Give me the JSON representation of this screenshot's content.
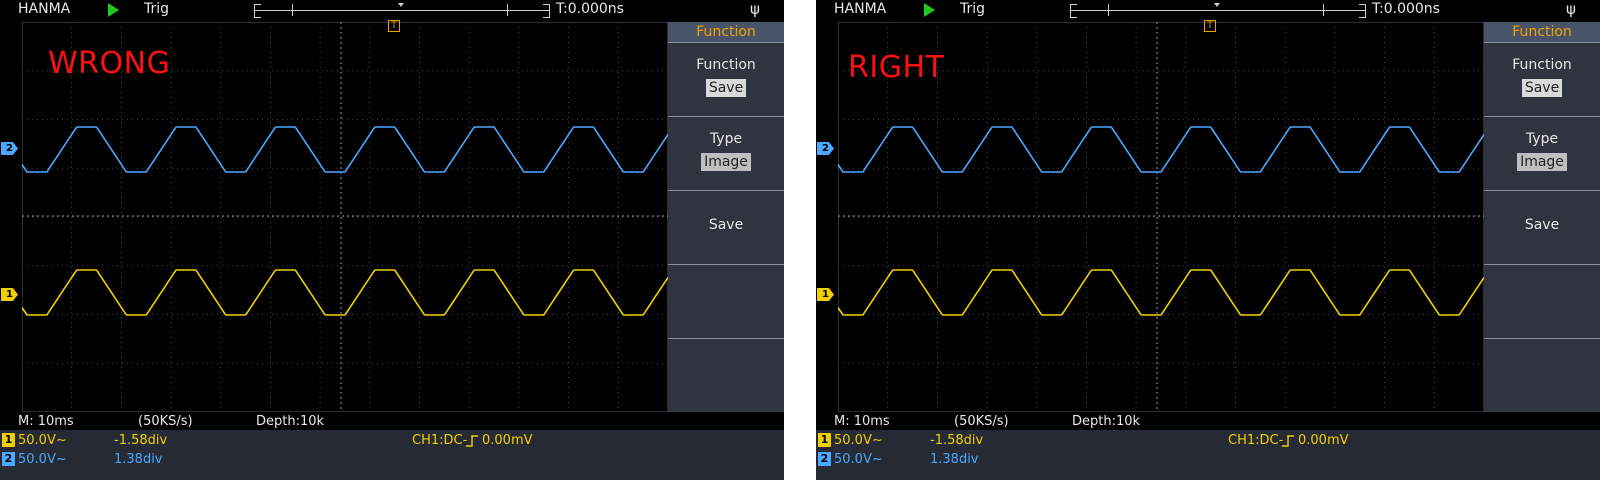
{
  "panels": [
    {
      "brand": "HANMA",
      "trig_label": "Trig",
      "time_pos": "T:0.000ns",
      "overlay": "WRONG",
      "trigger_marker": "T",
      "ch2_marker": "2",
      "ch1_marker": "1",
      "menu": {
        "title": "Function",
        "items": [
          {
            "label": "Function",
            "value": "Save"
          },
          {
            "label": "Type",
            "value": "Image"
          },
          {
            "label": "Save",
            "value": ""
          }
        ]
      },
      "status": {
        "timebase": "M: 10ms",
        "sample_rate": "(50KS/s)",
        "depth": "Depth:10k"
      },
      "channels": {
        "ch1": {
          "num": "1",
          "scale": "50.0V~",
          "offset": "-1.58div"
        },
        "ch2": {
          "num": "2",
          "scale": "50.0V~",
          "offset": "1.38div"
        },
        "trigger_info": "CH1:DC-",
        "trigger_slope_icon": "rising-edge-icon",
        "trigger_level": "0.00mV"
      }
    },
    {
      "brand": "HANMA",
      "trig_label": "Trig",
      "time_pos": "T:0.000ns",
      "overlay": "RIGHT",
      "trigger_marker": "T",
      "ch2_marker": "2",
      "ch1_marker": "1",
      "menu": {
        "title": "Function",
        "items": [
          {
            "label": "Function",
            "value": "Save"
          },
          {
            "label": "Type",
            "value": "Image"
          },
          {
            "label": "Save",
            "value": ""
          }
        ]
      },
      "status": {
        "timebase": "M: 10ms",
        "sample_rate": "(50KS/s)",
        "depth": "Depth:10k"
      },
      "channels": {
        "ch1": {
          "num": "1",
          "scale": "50.0V~",
          "offset": "-1.58div"
        },
        "ch2": {
          "num": "2",
          "scale": "50.0V~",
          "offset": "1.38div"
        },
        "trigger_info": "CH1:DC-",
        "trigger_slope_icon": "rising-edge-icon",
        "trigger_level": "0.00mV"
      }
    }
  ],
  "colors": {
    "ch1": "#f0d000",
    "ch2": "#4aa8ff",
    "overlay_text": "#ff1010",
    "accent": "#f0a400",
    "run_indicator": "#22c81f"
  },
  "waveforms": {
    "shape": "trapezoid",
    "cycles_on_screen": 6.5,
    "ch1_phase_offset_div": 0,
    "ch2_phase_offset_div": 0
  }
}
